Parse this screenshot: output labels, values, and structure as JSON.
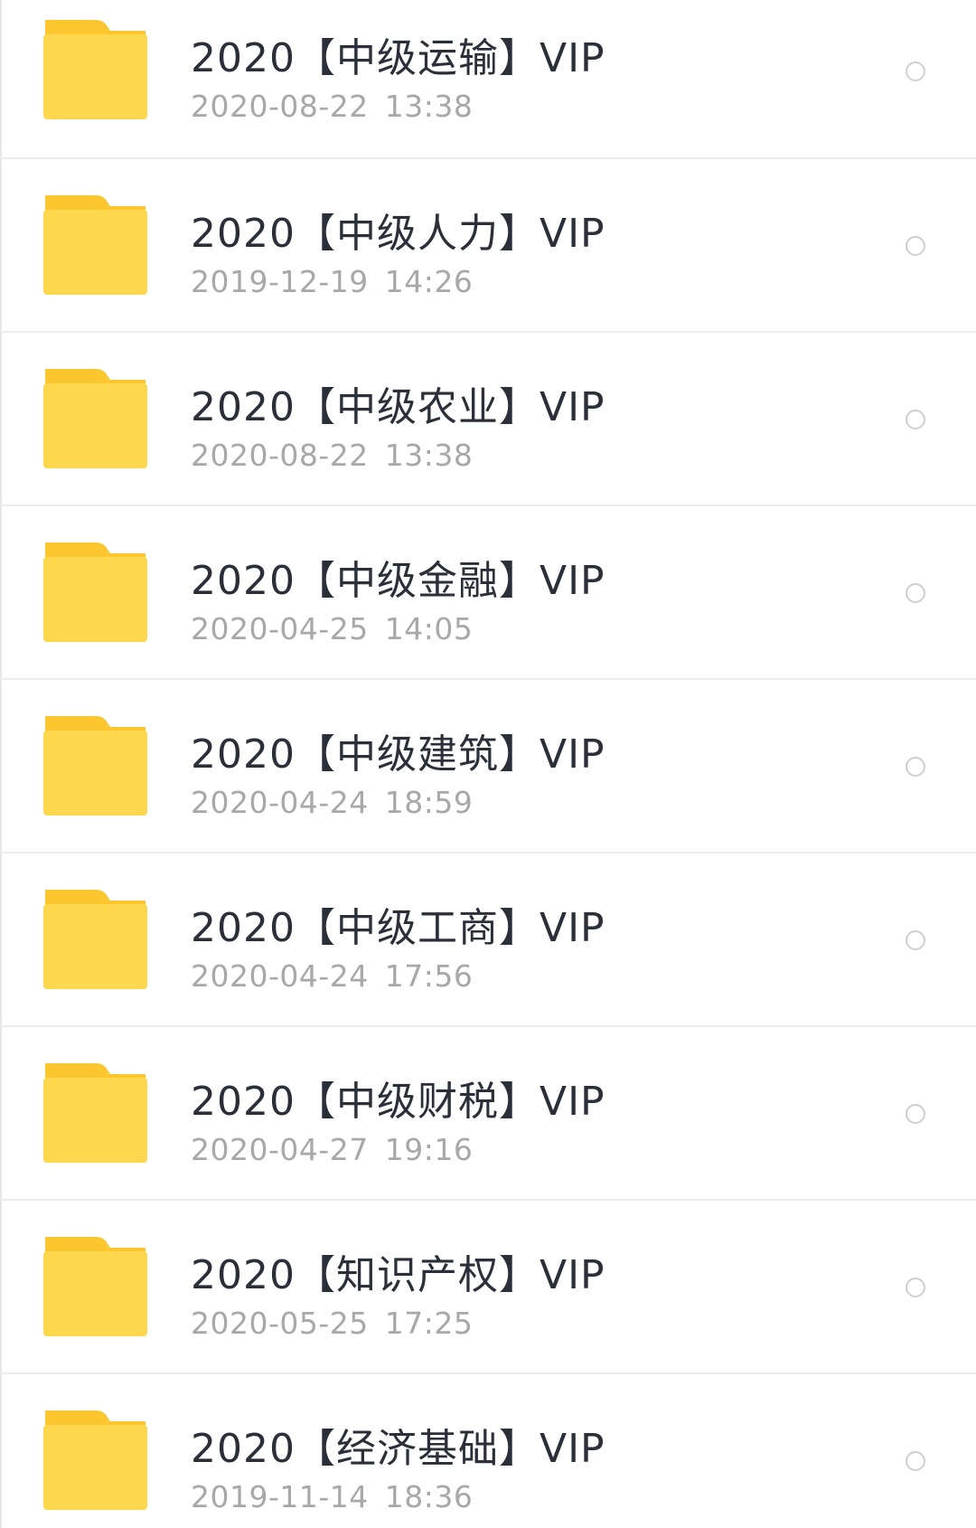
{
  "files": [
    {
      "name": "2020【中级运输】VIP",
      "date": "2020-08-22",
      "time": "13:38",
      "icon": "folder-icon"
    },
    {
      "name": "2020【中级人力】VIP",
      "date": "2019-12-19",
      "time": "14:26",
      "icon": "folder-icon"
    },
    {
      "name": "2020【中级农业】VIP",
      "date": "2020-08-22",
      "time": "13:38",
      "icon": "folder-icon"
    },
    {
      "name": "2020【中级金融】VIP",
      "date": "2020-04-25",
      "time": "14:05",
      "icon": "folder-icon"
    },
    {
      "name": "2020【中级建筑】VIP",
      "date": "2020-04-24",
      "time": "18:59",
      "icon": "folder-icon"
    },
    {
      "name": "2020【中级工商】VIP",
      "date": "2020-04-24",
      "time": "17:56",
      "icon": "folder-icon"
    },
    {
      "name": "2020【中级财税】VIP",
      "date": "2020-04-27",
      "time": "19:16",
      "icon": "folder-icon"
    },
    {
      "name": "2020【知识产权】VIP",
      "date": "2020-05-25",
      "time": "17:25",
      "icon": "folder-icon"
    },
    {
      "name": "2020【经济基础】VIP",
      "date": "2019-11-14",
      "time": "18:36",
      "icon": "folder-icon"
    }
  ],
  "colors": {
    "folder_body": "#fdd84e",
    "folder_tab": "#fbc62e",
    "title_text": "#2b2f3a",
    "meta_text": "#a8a8ab",
    "divider": "#ececec",
    "radio_border": "#cfcfd2"
  }
}
